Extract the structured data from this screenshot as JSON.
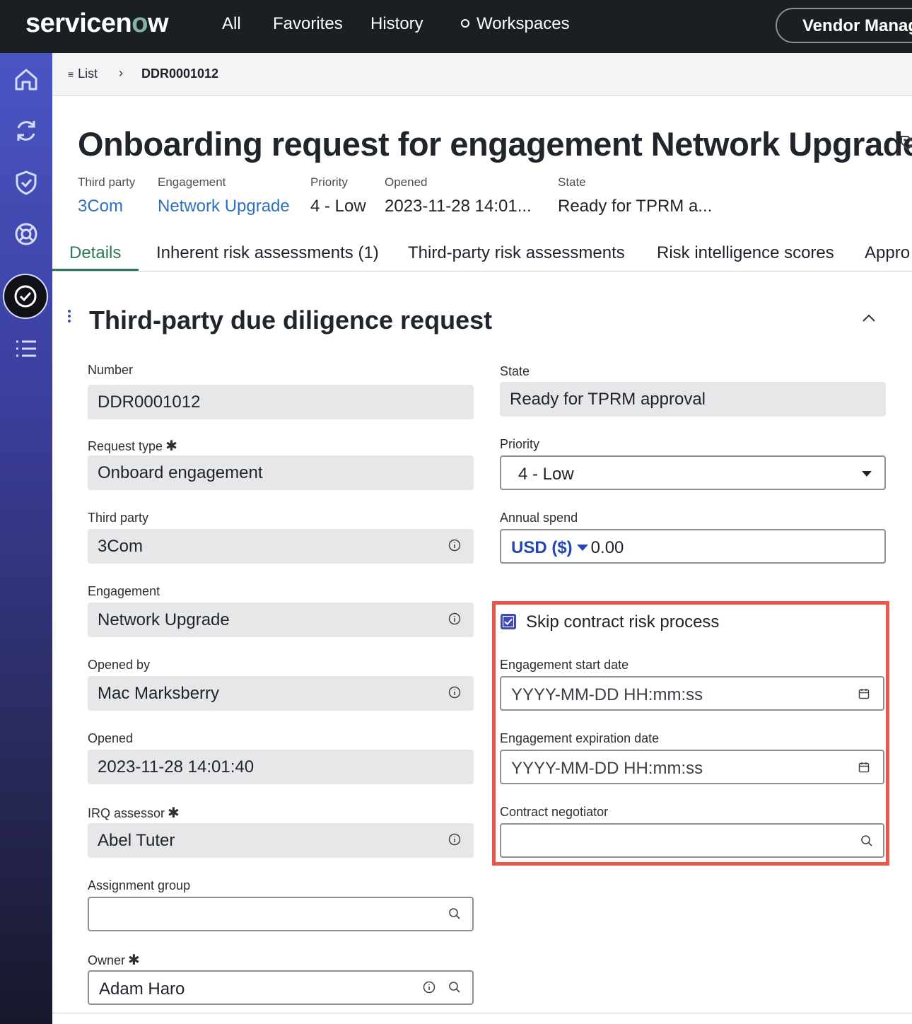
{
  "topbar": {
    "logo": "servicenow",
    "nav": [
      "All",
      "Favorites",
      "History",
      "Workspaces"
    ],
    "workspace_pill": "Vendor Manag"
  },
  "rail": {
    "icons": [
      "home-icon",
      "refresh-icon",
      "shield-check-icon",
      "help-ring-icon",
      "check-circle-icon",
      "list-icon"
    ],
    "active": "check-circle-icon"
  },
  "breadcrumb": {
    "list_label": "List",
    "current": "DDR0001012"
  },
  "header": {
    "title": "Onboarding request for engagement Network Upgrade",
    "meta": [
      {
        "label": "Third party",
        "value": "3Com"
      },
      {
        "label": "Engagement",
        "value": "Network Upgrade"
      },
      {
        "label": "Priority",
        "value": "4 - Low"
      },
      {
        "label": "Opened",
        "value": "2023-11-28 14:01..."
      },
      {
        "label": "State",
        "value": "Ready for TPRM a..."
      }
    ]
  },
  "tabs": [
    "Details",
    "Inherent risk assessments (1)",
    "Third-party risk assessments",
    "Risk intelligence scores",
    "Appro"
  ],
  "active_tab": "Details",
  "section": {
    "title": "Third-party due diligence request",
    "left": {
      "number": {
        "label": "Number",
        "value": "DDR0001012"
      },
      "request_type": {
        "label": "Request type",
        "value": "Onboard engagement"
      },
      "third_party": {
        "label": "Third party",
        "value": "3Com"
      },
      "engagement": {
        "label": "Engagement",
        "value": "Network Upgrade"
      },
      "opened_by": {
        "label": "Opened by",
        "value": "Mac Marksberry"
      },
      "opened": {
        "label": "Opened",
        "value": "2023-11-28 14:01:40"
      },
      "irq_assessor": {
        "label": "IRQ assessor",
        "value": "Abel Tuter"
      },
      "assignment_group": {
        "label": "Assignment group",
        "value": ""
      },
      "owner": {
        "label": "Owner",
        "value": "Adam Haro"
      }
    },
    "right": {
      "state": {
        "label": "State",
        "value": "Ready for TPRM approval"
      },
      "priority": {
        "label": "Priority",
        "value": "4 - Low"
      },
      "annual_spend": {
        "label": "Annual spend",
        "currency": "USD ($)",
        "value": "0.00"
      },
      "skip_contract": {
        "label": "Skip contract risk process",
        "checked": true
      },
      "engagement_start": {
        "label": "Engagement start date",
        "placeholder": "YYYY-MM-DD HH:mm:ss"
      },
      "engagement_expiration": {
        "label": "Engagement expiration date",
        "placeholder": "YYYY-MM-DD HH:mm:ss"
      },
      "contract_negotiator": {
        "label": "Contract negotiator",
        "value": ""
      }
    }
  },
  "colors": {
    "topbar": "#1a1f24",
    "accent_green": "#2f7a56",
    "link_blue": "#2e6fbf",
    "highlight_red": "#e8574a",
    "checkbox_blue": "#3b4ab8"
  }
}
